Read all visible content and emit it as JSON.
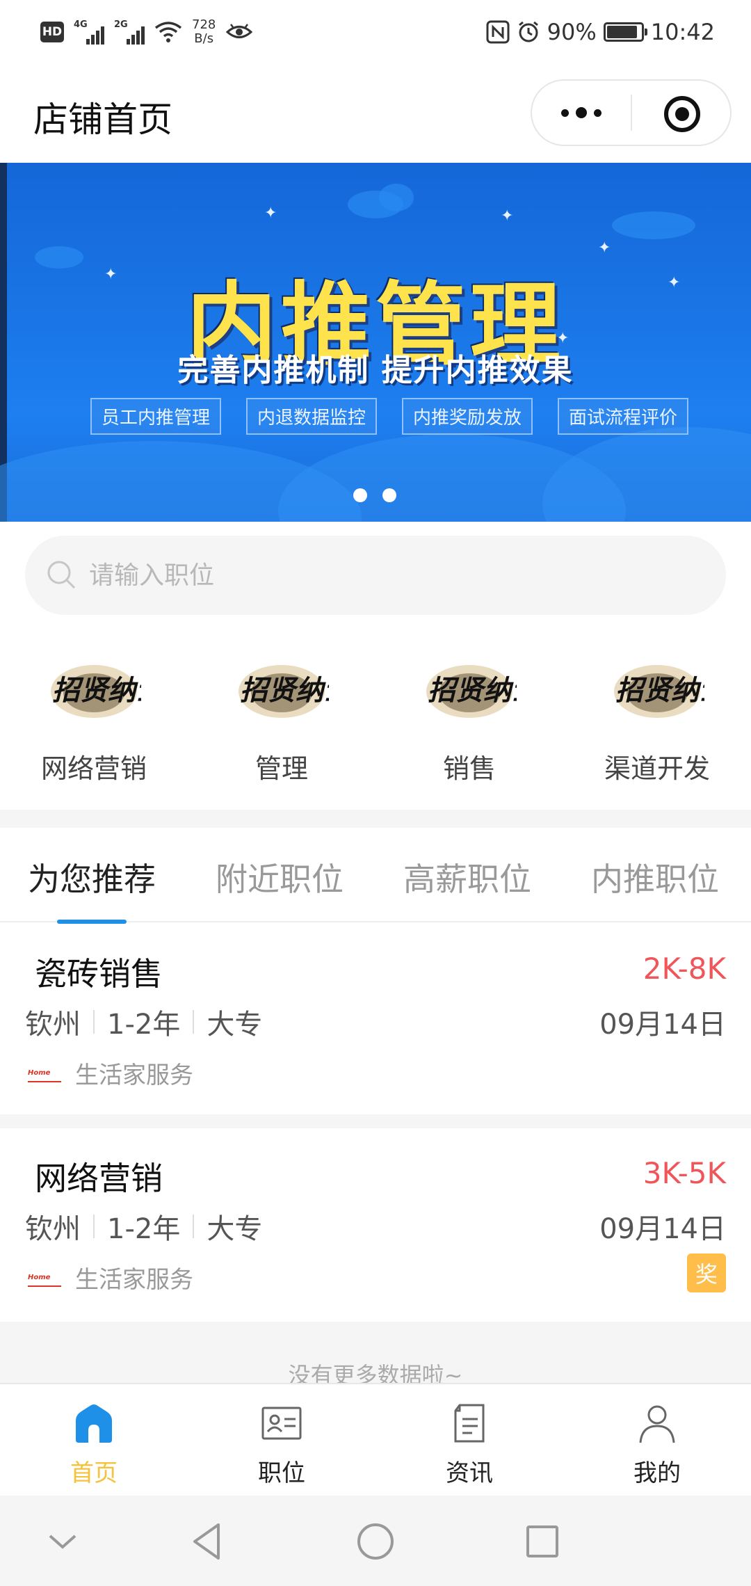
{
  "status_bar": {
    "hd": "HD",
    "net1": "4G",
    "net2": "2G",
    "speed_value": "728",
    "speed_unit": "B/s",
    "battery_pct": "90%",
    "battery_level": 0.9,
    "time": "10:42"
  },
  "nav": {
    "title": "店铺首页"
  },
  "banner": {
    "title": "内推管理",
    "subtitle": "完善内推机制  提升内推效果",
    "tags": [
      "员工内推管理",
      "内退数据监控",
      "内推奖励发放",
      "面试流程评价"
    ],
    "active_dot": 1,
    "dot_count": 2
  },
  "search": {
    "placeholder": "请输入职位"
  },
  "categories": [
    {
      "label": "网络营销",
      "logo_text": "招贤纳士"
    },
    {
      "label": "管理",
      "logo_text": "招贤纳士"
    },
    {
      "label": "销售",
      "logo_text": "招贤纳士"
    },
    {
      "label": "渠道开发",
      "logo_text": "招贤纳士"
    }
  ],
  "tabs": [
    "为您推荐",
    "附近职位",
    "高薪职位",
    "内推职位"
  ],
  "active_tab": 0,
  "jobs": [
    {
      "title": "瓷砖销售",
      "salary": "2K-8K",
      "city": "钦州",
      "experience": "1-2年",
      "education": "大专",
      "date": "09月14日",
      "company": "生活家服务",
      "company_logo": "Home",
      "badge": ""
    },
    {
      "title": "网络营销",
      "salary": "3K-5K",
      "city": "钦州",
      "experience": "1-2年",
      "education": "大专",
      "date": "09月14日",
      "company": "生活家服务",
      "company_logo": "Home",
      "badge": "奖"
    }
  ],
  "no_more": "没有更多数据啦~",
  "tabbar": [
    {
      "label": "首页",
      "icon": "home-icon",
      "active": true
    },
    {
      "label": "职位",
      "icon": "id-card-icon",
      "active": false
    },
    {
      "label": "资讯",
      "icon": "document-icon",
      "active": false
    },
    {
      "label": "我的",
      "icon": "user-icon",
      "active": false
    }
  ],
  "colors": {
    "accent_blue": "#1e90e8",
    "salary_red": "#f0555a",
    "tab_active_yellow": "#f5c23a",
    "badge_orange": "#ffbd4a",
    "banner_title_yellow": "#ffe34c"
  }
}
